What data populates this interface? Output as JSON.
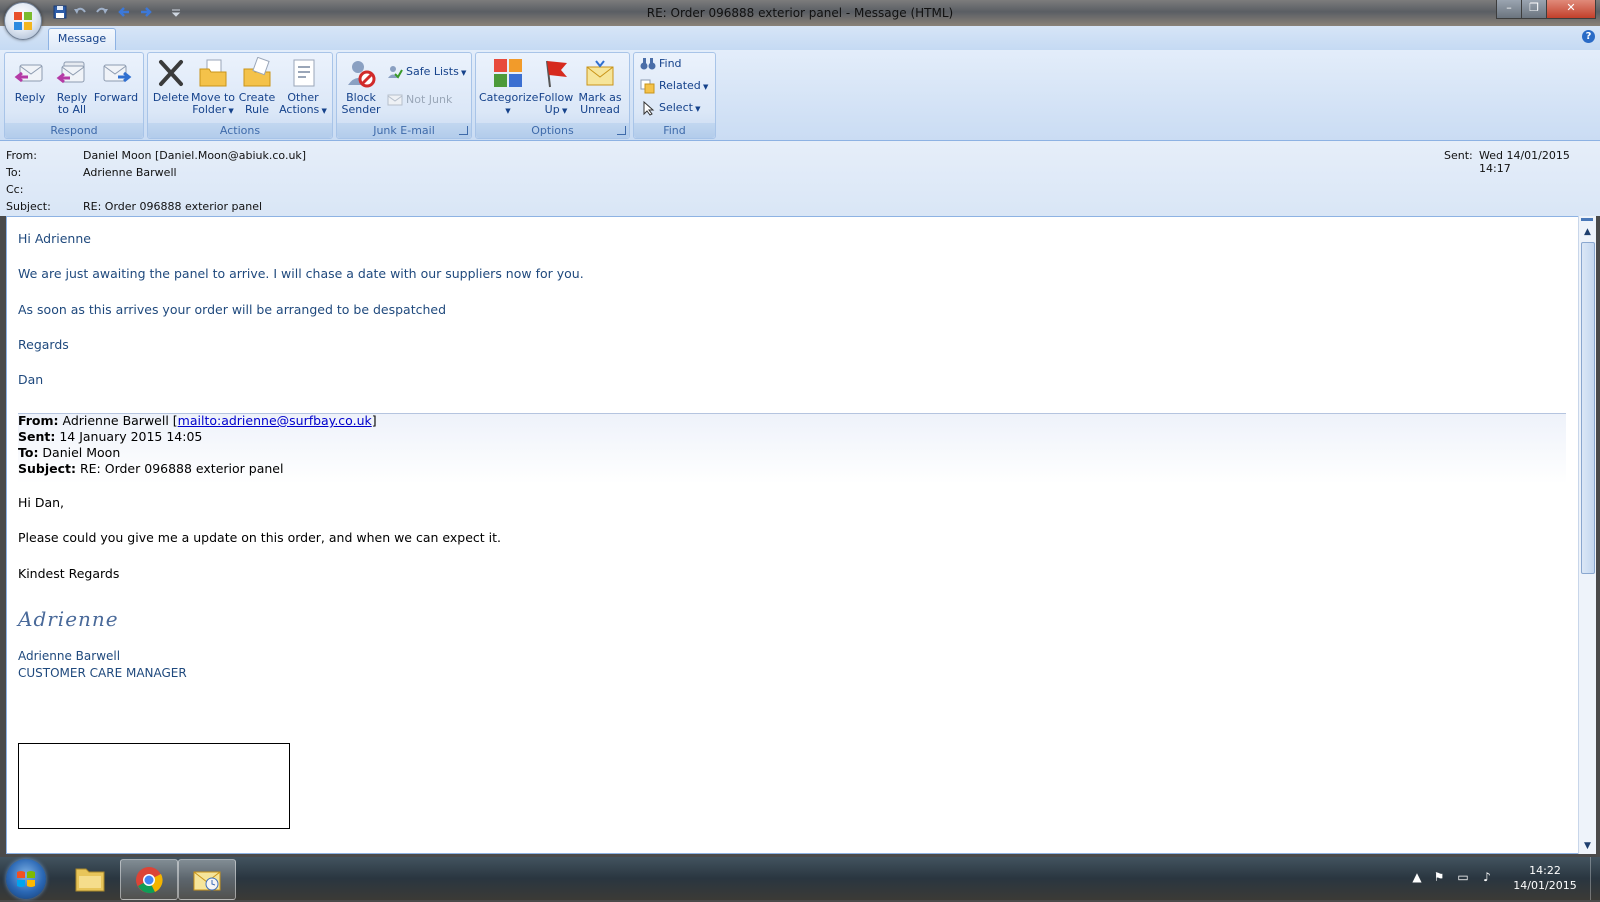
{
  "window": {
    "title": "RE: Order 096888 exterior panel - Message (HTML)",
    "controls": {
      "minimize": "–",
      "maximize": "❐",
      "close": "✕"
    }
  },
  "ribbon": {
    "tabs": [
      "Message"
    ],
    "help": "?",
    "groups": {
      "respond": {
        "label": "Respond",
        "reply": "Reply",
        "reply_all_1": "Reply",
        "reply_all_2": "to All",
        "forward": "Forward"
      },
      "actions": {
        "label": "Actions",
        "delete": "Delete",
        "move_1": "Move to",
        "move_2": "Folder",
        "create_1": "Create",
        "create_2": "Rule",
        "other_1": "Other",
        "other_2": "Actions"
      },
      "junk": {
        "label": "Junk E-mail",
        "block_1": "Block",
        "block_2": "Sender",
        "safe_lists": "Safe Lists",
        "not_junk": "Not Junk"
      },
      "options": {
        "label": "Options",
        "categorize": "Categorize",
        "follow_1": "Follow",
        "follow_2": "Up",
        "mark_1": "Mark as",
        "mark_2": "Unread"
      },
      "find": {
        "label": "Find",
        "find": "Find",
        "related": "Related",
        "select": "Select"
      }
    }
  },
  "header": {
    "from_label": "From:",
    "from_value": "Daniel Moon [Daniel.Moon@abiuk.co.uk]",
    "to_label": "To:",
    "to_value": "Adrienne Barwell",
    "cc_label": "Cc:",
    "subject_label": "Subject:",
    "subject_value": "RE: Order 096888 exterior panel",
    "sent_label": "Sent:",
    "sent_value": "Wed 14/01/2015 14:17"
  },
  "body": {
    "greeting": "Hi Adrienne",
    "line1": "We are just awaiting the panel to arrive. I will chase a date with our suppliers now for you.",
    "line2": "As soon as this arrives your order will be arranged to be despatched",
    "regards": "Regards",
    "sign": "Dan",
    "quoted": {
      "from_label": "From:",
      "from_name": " Adrienne Barwell [",
      "from_link": "mailto:adrienne@surfbay.co.uk",
      "from_close": "]",
      "sent_label": "Sent:",
      "sent_value": " 14 January 2015 14:05",
      "to_label": "To:",
      "to_value": " Daniel Moon",
      "subject_label": "Subject:",
      "subject_value": " RE: Order 096888 exterior panel",
      "greeting": "Hi Dan,",
      "line1": "Please could you give me a update on this order, and when we can expect it.",
      "regards": "Kindest Regards",
      "signature_script": "Adrienne",
      "name": "Adrienne Barwell",
      "role": "CUSTOMER CARE MANAGER"
    }
  },
  "taskbar": {
    "time": "14:22",
    "date": "14/01/2015"
  },
  "colors": {
    "ribbon_text": "#15428b",
    "body_blue": "#1f497d",
    "link": "#0000cc"
  }
}
